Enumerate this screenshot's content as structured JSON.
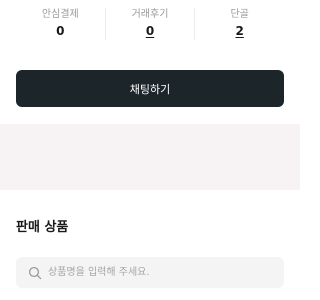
{
  "stats": [
    {
      "label": "안심결제",
      "value": "0"
    },
    {
      "label": "거래후기",
      "value": "0"
    },
    {
      "label": "단골",
      "value": "2"
    }
  ],
  "chat_button": {
    "label": "채팅하기"
  },
  "section": {
    "title": "판매 상품"
  },
  "search": {
    "placeholder": "상품명을 입력해 주세요.",
    "value": "",
    "icon": "search-icon"
  },
  "colors": {
    "button_bg": "#1b252a",
    "band_bg": "#f7f2f4",
    "search_bg": "#f4f4f5"
  }
}
